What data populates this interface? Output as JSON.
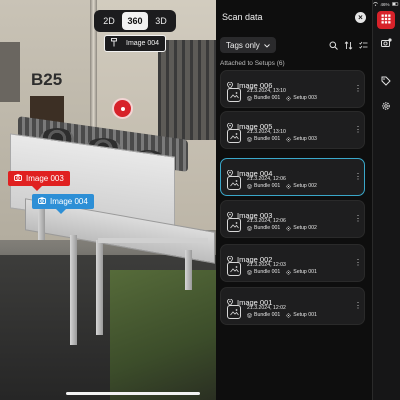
{
  "viewer": {
    "building_label": "B25",
    "modes": [
      "2D",
      "360",
      "3D"
    ],
    "active_mode": "360",
    "current_image": "Image 004",
    "tags": [
      {
        "label": "Image 003",
        "color": "#e02020"
      },
      {
        "label": "Image 004",
        "color": "#2d8fd6"
      }
    ]
  },
  "panel": {
    "title": "Scan data",
    "filter": "Tags only",
    "section_label": "Attached to Setups (6)",
    "selected_color": "#3aa7c9",
    "cards": [
      {
        "title": "Image 006",
        "date": "21.3.2024, 13:10",
        "bundle": "Bundle 001",
        "setup": "Setup 003",
        "selected": false
      },
      {
        "title": "Image 005",
        "date": "21.3.2024, 13:10",
        "bundle": "Bundle 001",
        "setup": "Setup 003",
        "selected": false
      },
      {
        "title": "Image 004",
        "date": "21.3.2024, 12:06",
        "bundle": "Bundle 001",
        "setup": "Setup 002",
        "selected": true
      },
      {
        "title": "Image 003",
        "date": "21.3.2024, 12:06",
        "bundle": "Bundle 001",
        "setup": "Setup 002",
        "selected": false
      },
      {
        "title": "Image 002",
        "date": "21.3.2024, 12:03",
        "bundle": "Bundle 001",
        "setup": "Setup 001",
        "selected": false
      },
      {
        "title": "Image 001",
        "date": "21.3.2024, 12:02",
        "bundle": "Bundle 001",
        "setup": "Setup 001",
        "selected": false
      }
    ]
  },
  "status": {
    "battery": "46%"
  },
  "rail": {
    "accent": "#d7222a",
    "items": [
      "grid-icon",
      "camera-settings-icon",
      "tag-icon",
      "gear-icon"
    ]
  }
}
